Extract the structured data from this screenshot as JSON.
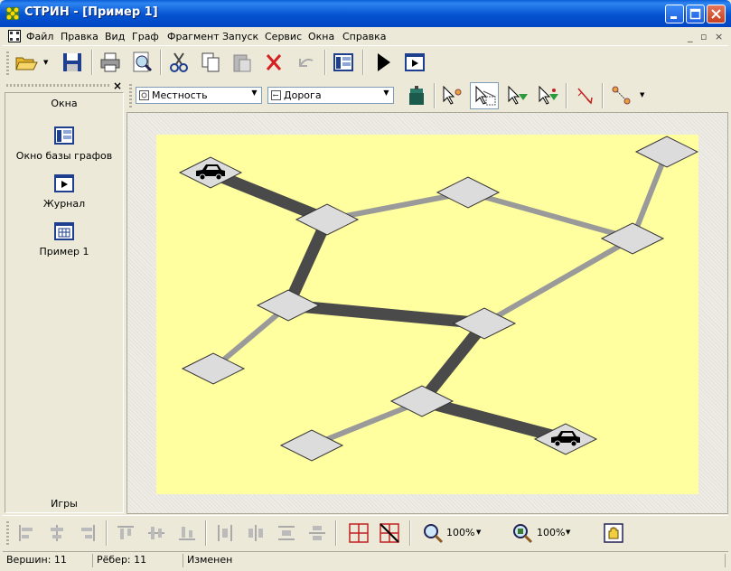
{
  "window": {
    "title": "СТРИН - [Пример 1]"
  },
  "menu": [
    "Файл",
    "Правка",
    "Вид",
    "Граф",
    "Фрагмент",
    "Запуск",
    "Сервис",
    "Окна",
    "Справка"
  ],
  "panel": {
    "heading": "Окна",
    "items": [
      {
        "label": "Окно базы графов",
        "icon": "graph-db-icon"
      },
      {
        "label": "Журнал",
        "icon": "journal-icon"
      },
      {
        "label": "Пример 1",
        "icon": "example-doc-icon"
      }
    ],
    "footer": "Игры"
  },
  "graph_toolbar": {
    "terrain_value": "Местность",
    "road_value": "Дорога"
  },
  "zoom": {
    "left": "100%",
    "right": "100%"
  },
  "status": {
    "vertices": "Вершин: 11",
    "edges": "Рёбер: 11",
    "state": "Изменен"
  },
  "graph": {
    "nodes": [
      {
        "id": "n1",
        "car": true
      },
      {
        "id": "n2"
      },
      {
        "id": "n3"
      },
      {
        "id": "n4"
      },
      {
        "id": "n5"
      },
      {
        "id": "n6"
      },
      {
        "id": "n7"
      },
      {
        "id": "n8"
      },
      {
        "id": "n9"
      },
      {
        "id": "n10",
        "car": true
      },
      {
        "id": "n11"
      }
    ],
    "edges": [
      {
        "from": "n1",
        "to": "n2",
        "kind": "dark"
      },
      {
        "from": "n2",
        "to": "n3",
        "kind": "light"
      },
      {
        "from": "n3",
        "to": "n4",
        "kind": "light"
      },
      {
        "from": "n4",
        "to": "n5",
        "kind": "light"
      },
      {
        "from": "n2",
        "to": "n6",
        "kind": "dark"
      },
      {
        "from": "n6",
        "to": "n7",
        "kind": "light"
      },
      {
        "from": "n6",
        "to": "n8",
        "kind": "dark"
      },
      {
        "from": "n8",
        "to": "n4",
        "kind": "light"
      },
      {
        "from": "n8",
        "to": "n9",
        "kind": "dark"
      },
      {
        "from": "n9",
        "to": "n10",
        "kind": "dark"
      },
      {
        "from": "n9",
        "to": "n11",
        "kind": "light"
      }
    ],
    "colors": {
      "background": "#ffff9f",
      "node_fill": "#dcdcdc",
      "edge_dark": "#4a4a4a",
      "edge_light": "#9a9a9a"
    }
  }
}
